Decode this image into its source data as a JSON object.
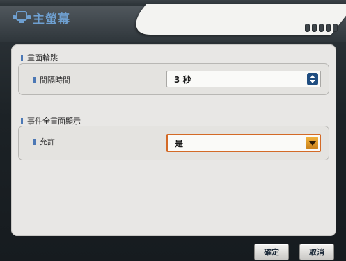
{
  "header": {
    "title": "主螢幕",
    "app_icon": "monitor-icon",
    "signal_icon": "signal-indicator-icon"
  },
  "sections": [
    {
      "title": "畫面輪跳",
      "row": {
        "label": "間隔時間",
        "value": "3 秒",
        "control": "spinner"
      }
    },
    {
      "title": "事件全畫面顯示",
      "row": {
        "label": "允許",
        "value": "是",
        "control": "dropdown"
      }
    }
  ],
  "footer": {
    "ok_label": "確定",
    "cancel_label": "取消"
  },
  "colors": {
    "title_blue": "#6e9fd0",
    "focus_orange": "#d36a27",
    "spinner_blue": "#1f4d80",
    "dropdown_orange": "#e29a2b"
  }
}
